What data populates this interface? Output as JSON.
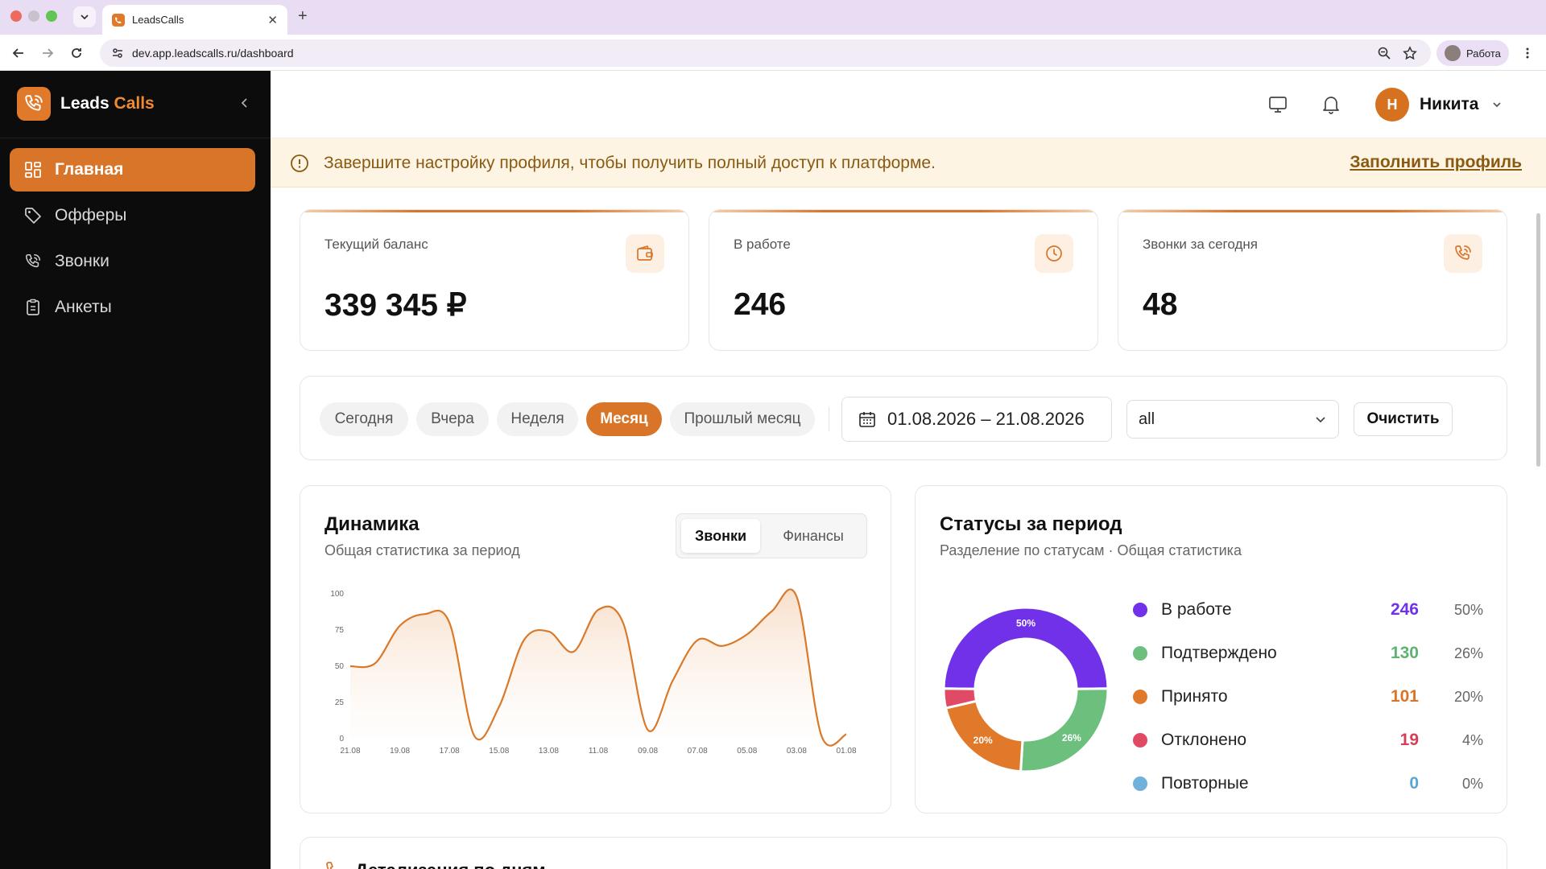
{
  "browser": {
    "tab_title": "LeadsCalls",
    "url": "dev.app.leadscalls.ru/dashboard",
    "profile_label": "Работа"
  },
  "sidebar": {
    "logo_first": "Leads",
    "logo_second": "Calls",
    "items": [
      {
        "label": "Главная",
        "icon": "grid-icon",
        "active": true
      },
      {
        "label": "Офферы",
        "icon": "tag-icon",
        "active": false
      },
      {
        "label": "Звонки",
        "icon": "phone-icon",
        "active": false
      },
      {
        "label": "Анкеты",
        "icon": "clipboard-icon",
        "active": false
      }
    ]
  },
  "header": {
    "user_initial": "Н",
    "user_name": "Никита"
  },
  "banner": {
    "text": "Завершите настройку профиля, чтобы получить полный доступ к платформе.",
    "link": "Заполнить профиль"
  },
  "stats": [
    {
      "label": "Текущий баланс",
      "value": "339 345 ₽",
      "icon": "wallet-icon"
    },
    {
      "label": "В работе",
      "value": "246",
      "icon": "clock-icon"
    },
    {
      "label": "Звонки за сегодня",
      "value": "48",
      "icon": "phone-icon"
    }
  ],
  "filters": {
    "periods": [
      "Сегодня",
      "Вчера",
      "Неделя",
      "Месяц",
      "Прошлый месяц"
    ],
    "active_period": "Месяц",
    "date_range": "01.08.2026 – 21.08.2026",
    "select_value": "all",
    "clear_label": "Очистить"
  },
  "dynamics": {
    "title": "Динамика",
    "subtitle": "Общая статистика за период",
    "tabs": [
      "Звонки",
      "Финансы"
    ],
    "active_tab": "Звонки"
  },
  "chart_data": {
    "type": "area",
    "x": [
      "21.08",
      "20.08",
      "19.08",
      "18.08",
      "17.08",
      "16.08",
      "15.08",
      "14.08",
      "13.08",
      "12.08",
      "11.08",
      "10.08",
      "09.08",
      "08.08",
      "07.08",
      "06.08",
      "05.08",
      "04.08",
      "03.08",
      "02.08",
      "01.08"
    ],
    "tick_labels": [
      "21.08",
      "19.08",
      "17.08",
      "15.08",
      "13.08",
      "11.08",
      "09.08",
      "07.08",
      "05.08",
      "03.08",
      "01.08"
    ],
    "values": [
      50,
      52,
      78,
      86,
      80,
      2,
      22,
      68,
      74,
      60,
      89,
      80,
      6,
      40,
      68,
      64,
      72,
      88,
      98,
      2,
      3
    ],
    "yticks": [
      0,
      25,
      50,
      75,
      100
    ],
    "ylim": [
      0,
      100
    ],
    "color": "#d9792a"
  },
  "statuses": {
    "title": "Статусы за период",
    "subtitle": "Разделение по статусам · Общая статистика",
    "items": [
      {
        "name": "В работе",
        "count": "246",
        "pct": "50%",
        "color": "#7131e9"
      },
      {
        "name": "Подтверждено",
        "count": "130",
        "pct": "26%",
        "color": "#6dbf7e"
      },
      {
        "name": "Принято",
        "count": "101",
        "pct": "20%",
        "color": "#e07a2a"
      },
      {
        "name": "Отклонено",
        "count": "19",
        "pct": "4%",
        "color": "#e04a64"
      },
      {
        "name": "Повторные",
        "count": "0",
        "pct": "0%",
        "color": "#6fb1d8"
      }
    ],
    "donut_labels": [
      "50%",
      "26%",
      "20%"
    ]
  },
  "detail": {
    "title": "Детализация по дням"
  }
}
